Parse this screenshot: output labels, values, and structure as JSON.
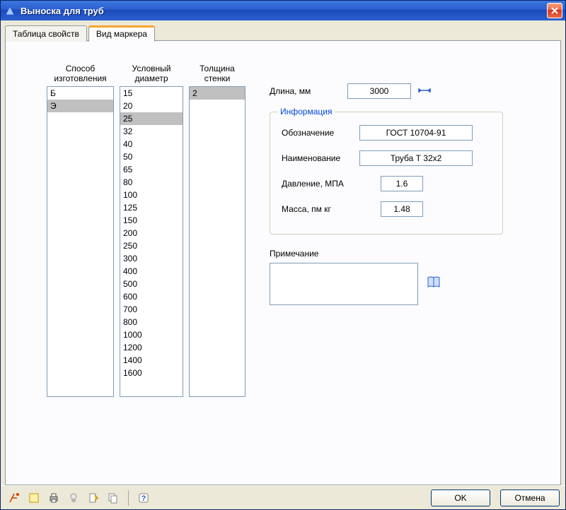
{
  "window": {
    "title": "Выноска для труб"
  },
  "tabs": [
    {
      "label": "Таблица свойств",
      "active": false
    },
    {
      "label": "Вид маркера",
      "active": true
    }
  ],
  "columns": [
    {
      "header1": "Способ",
      "header2": "изготовления",
      "items": [
        "Б",
        "Э"
      ],
      "selected": "Э"
    },
    {
      "header1": "Условный",
      "header2": "диаметр",
      "items": [
        "15",
        "20",
        "25",
        "32",
        "40",
        "50",
        "65",
        "80",
        "100",
        "125",
        "150",
        "200",
        "250",
        "300",
        "400",
        "500",
        "600",
        "700",
        "800",
        "1000",
        "1200",
        "1400",
        "1600"
      ],
      "selected": "25"
    },
    {
      "header1": "Толщина",
      "header2": "стенки",
      "items": [
        "2"
      ],
      "selected": "2"
    }
  ],
  "length": {
    "label": "Длина, мм",
    "value": "3000"
  },
  "info": {
    "legend": "Информация",
    "designation_label": "Обозначение",
    "designation_value": "ГОСТ 10704-91",
    "name_label": "Наименование",
    "name_value": "Труба Т 32x2",
    "pressure_label": "Давление, МПА",
    "pressure_value": "1.6",
    "mass_label": "Масса, пм кг",
    "mass_value": "1.48"
  },
  "note": {
    "label": "Примечание",
    "value": ""
  },
  "buttons": {
    "ok": "OK",
    "cancel": "Отмена"
  },
  "toolbar_icons": [
    "annotation-icon",
    "note-icon",
    "print-icon",
    "bulb-icon",
    "edit-icon",
    "copy-icon",
    "help-icon"
  ]
}
